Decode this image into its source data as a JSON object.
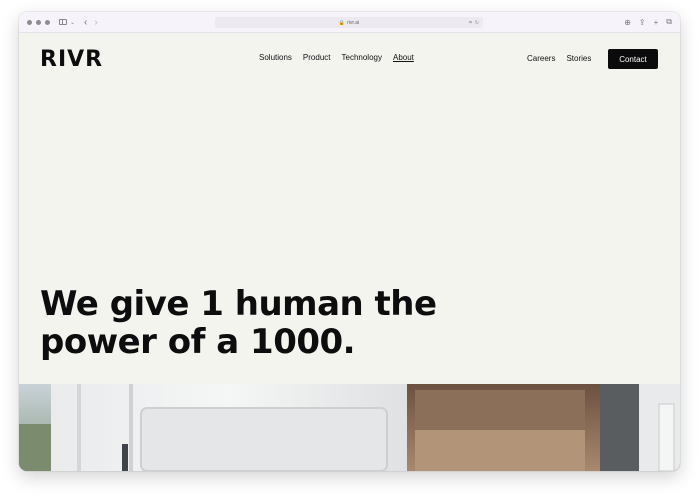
{
  "browser": {
    "address_text": "rivr.ai"
  },
  "site": {
    "logo_text": "RIVR",
    "nav": {
      "items": [
        {
          "label": "Solutions"
        },
        {
          "label": "Product"
        },
        {
          "label": "Technology"
        },
        {
          "label": "About"
        }
      ],
      "active": "About"
    },
    "nav_right": {
      "careers": "Careers",
      "stories": "Stories",
      "contact": "Contact"
    },
    "headline": {
      "line1": "We give 1 human the",
      "line2": "power of a 1000."
    }
  },
  "colors": {
    "page_bg": "#f4f4ef",
    "text": "#0d0d0d",
    "button_bg": "#0b0b0b",
    "button_text": "#ffffff"
  },
  "icons": [
    "sidebar-icon",
    "back-icon",
    "forward-icon",
    "lock-icon",
    "translate-icon",
    "reload-icon",
    "download-icon",
    "share-icon",
    "new-tab-icon",
    "tabs-icon"
  ]
}
